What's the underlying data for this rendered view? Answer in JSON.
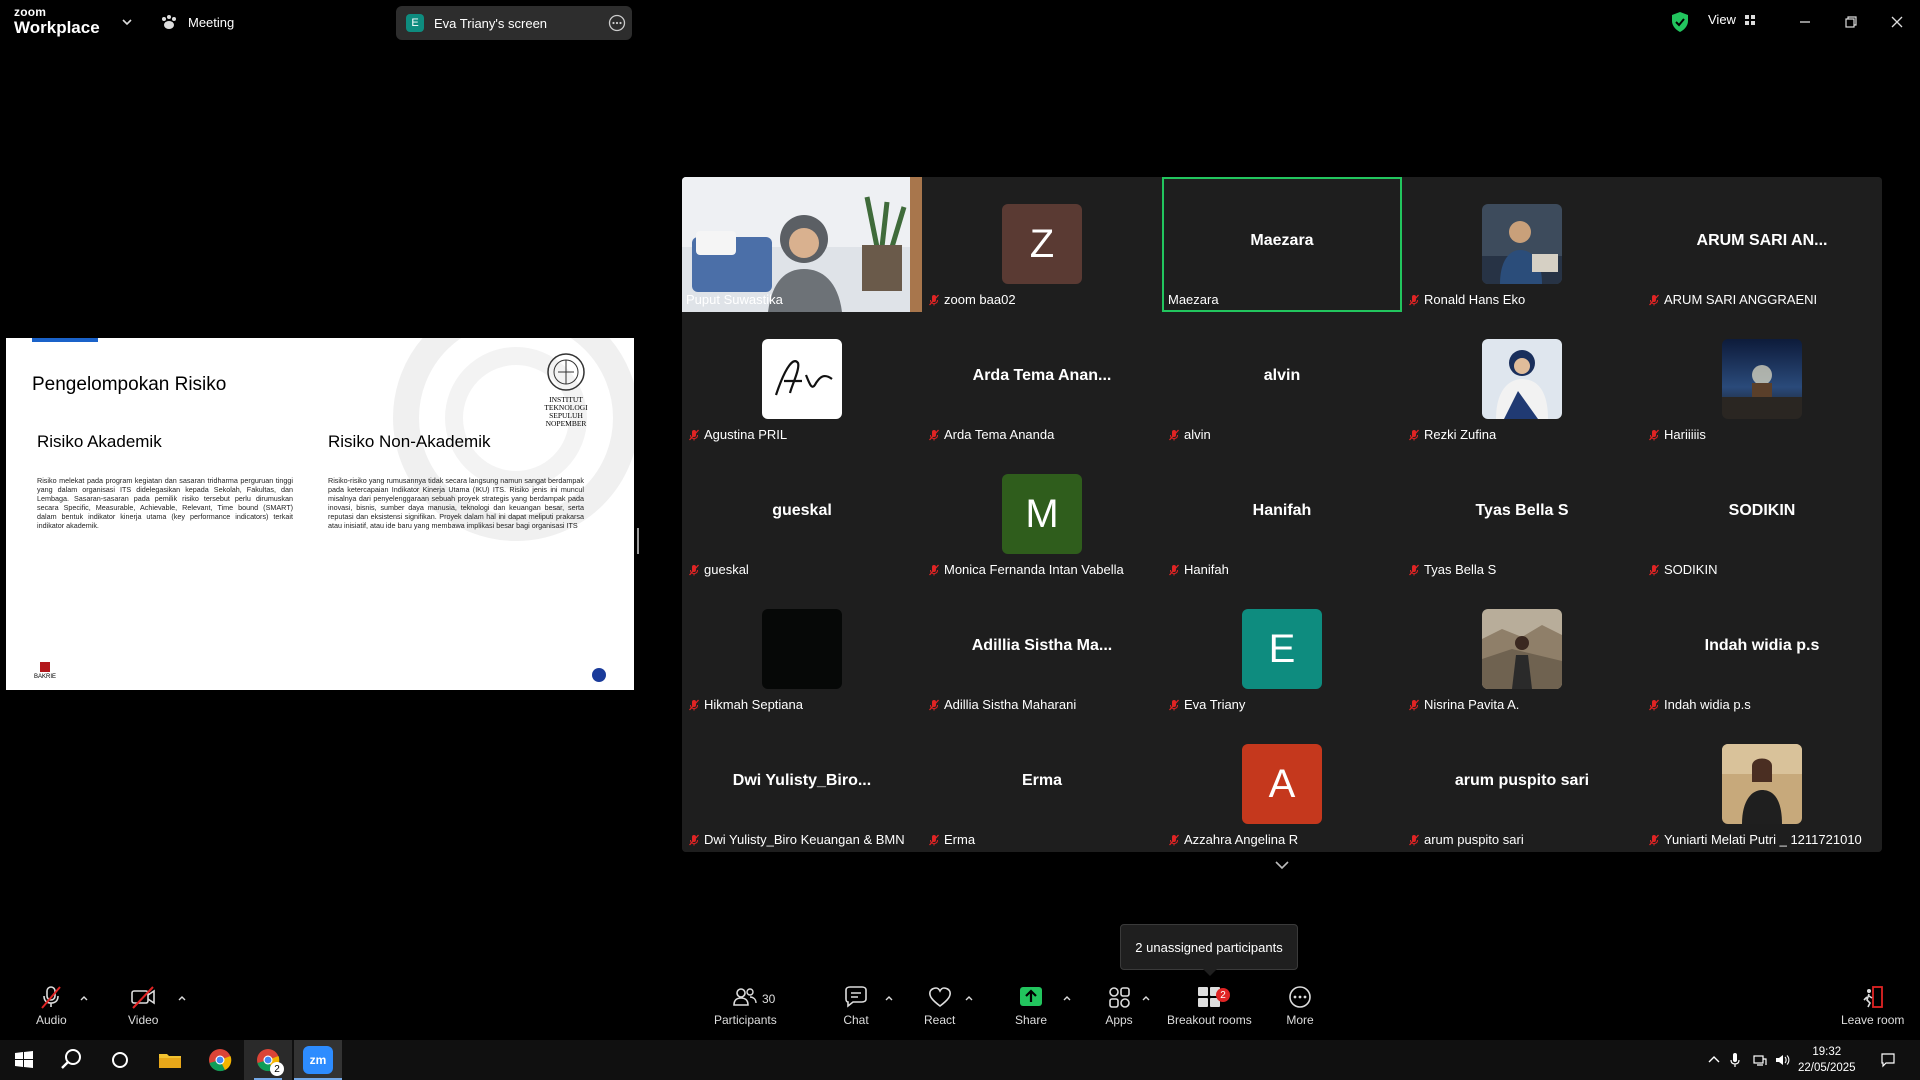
{
  "topbar": {
    "logo_line1": "zoom",
    "logo_line2": "Workplace",
    "meeting_label": "Meeting",
    "screen_badge": "E",
    "screen_label": "Eva Triany's screen",
    "view_label": "View"
  },
  "slide": {
    "title": "Pengelompokan Risiko",
    "col1_title": "Risiko Akademik",
    "col1_text": "Risiko melekat pada program kegiatan dan sasaran tridharma perguruan tinggi yang dalam organisasi ITS didelegasikan kepada Sekolah, Fakultas, dan Lembaga. Sasaran-sasaran pada pemilik risiko tersebut perlu dirumuskan secara Specific, Measurable, Achievable, Relevant, Time bound (SMART) dalam bentuk indikator kinerja utama (key performance indicators) terkait indikator akademik.",
    "col2_title": "Risiko Non-Akademik",
    "col2_text": "Risiko-risiko yang rumusannya tidak secara langsung namun sangat berdampak pada ketercapaian Indikator Kinerja Utama (IKU) ITS. Risiko jenis ini muncul misalnya dari penyelenggaraan sebuah proyek strategis yang berdampak pada inovasi, bisnis, sumber daya manusia, teknologi dan keuangan besar, serta reputasi dan eksistensi signifikan. Proyek dalam hal ini dapat meliputi prakarsa atau inisiatif, atau ide baru yang membawa implikasi besar bagi organisasi ITS",
    "its_line1": "INSTITUT TEKNOLOGI",
    "its_line2": "SEPULUH NOPEMBER",
    "bakrie": "BAKRIE"
  },
  "participants": [
    {
      "label": "Puput Suwastika",
      "type": "video"
    },
    {
      "label": "zoom baa02",
      "type": "avatar",
      "letter": "Z",
      "color": "#5a3a33"
    },
    {
      "label": "Maezara",
      "type": "name",
      "big": "Maezara",
      "active": true
    },
    {
      "label": "Ronald Hans Eko",
      "type": "photo",
      "photo": "ronald"
    },
    {
      "label": "ARUM SARI ANGGRAENI",
      "type": "name",
      "big": "ARUM SARI AN..."
    },
    {
      "label": "Agustina PRIL",
      "type": "photo",
      "photo": "signature"
    },
    {
      "label": "Arda Tema Ananda",
      "type": "name",
      "big": "Arda Tema Anan..."
    },
    {
      "label": "alvin",
      "type": "name",
      "big": "alvin"
    },
    {
      "label": "Rezki Zufina",
      "type": "photo",
      "photo": "rezki"
    },
    {
      "label": "Hariiiiis",
      "type": "photo",
      "photo": "night"
    },
    {
      "label": "gueskal",
      "type": "name",
      "big": "gueskal"
    },
    {
      "label": "Monica Fernanda Intan Vabella",
      "type": "avatar",
      "letter": "M",
      "color": "#2f5d1c"
    },
    {
      "label": "Hanifah",
      "type": "name",
      "big": "Hanifah"
    },
    {
      "label": "Tyas Bella S",
      "type": "name",
      "big": "Tyas Bella S"
    },
    {
      "label": "SODIKIN",
      "type": "name",
      "big": "SODIKIN"
    },
    {
      "label": "Hikmah Septiana",
      "type": "photo",
      "photo": "black"
    },
    {
      "label": "Adillia Sistha Maharani",
      "type": "name",
      "big": "Adillia Sistha Ma..."
    },
    {
      "label": "Eva Triany",
      "type": "avatar",
      "letter": "E",
      "color": "#0e8c7f"
    },
    {
      "label": "Nisrina Pavita A.",
      "type": "photo",
      "photo": "nisrina"
    },
    {
      "label": "Indah widia p.s",
      "type": "name",
      "big": "Indah widia p.s"
    },
    {
      "label": "Dwi Yulisty_Biro Keuangan & BMN",
      "type": "name",
      "big": "Dwi Yulisty_Biro..."
    },
    {
      "label": "Erma",
      "type": "name",
      "big": "Erma"
    },
    {
      "label": "Azzahra Angelina R",
      "type": "avatar",
      "letter": "A",
      "color": "#c5381d"
    },
    {
      "label": "arum puspito sari",
      "type": "name",
      "big": "arum puspito sari"
    },
    {
      "label": "Yuniarti Melati Putri _ 1211721010",
      "type": "photo",
      "photo": "yuniarti"
    }
  ],
  "tooltip": "2 unassigned participants",
  "toolbar": {
    "audio": "Audio",
    "video": "Video",
    "participants": "Participants",
    "participants_count": "30",
    "chat": "Chat",
    "react": "React",
    "share": "Share",
    "apps": "Apps",
    "breakout": "Breakout rooms",
    "breakout_badge": "2",
    "more": "More",
    "leave": "Leave room"
  },
  "taskbar": {
    "time": "19:32",
    "date": "22/05/2025",
    "chrome_badge": "2",
    "zoom_label": "zm"
  },
  "colors": {
    "accent_green": "#22c55e",
    "share_green": "#22c55e",
    "badge_red": "#e02424"
  }
}
